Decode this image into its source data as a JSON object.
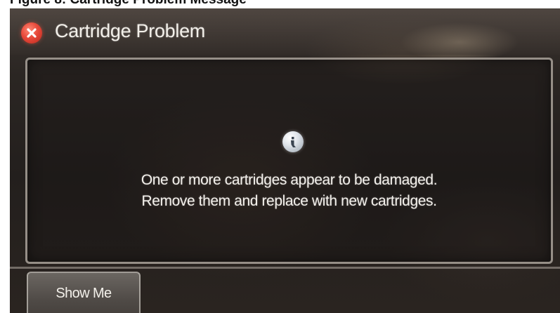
{
  "caption": {
    "text": "Figure 8: Cartridge Problem Message"
  },
  "dialog": {
    "title": "Cartridge Problem",
    "close_icon": "close-x-icon",
    "info_icon": "info-icon",
    "message_lines": [
      "One or more cartridges appear to be damaged.",
      "Remove them and replace with new cartridges."
    ]
  },
  "actions": {
    "show_me_label": "Show Me"
  },
  "colors": {
    "close_button": "#e8493a",
    "panel_border": "#beb6ac",
    "text": "#f4f1ec",
    "background": "#231f1d"
  }
}
